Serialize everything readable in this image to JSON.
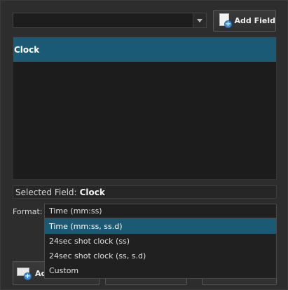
{
  "toolbar": {
    "field_select_value": "",
    "add_field_label": "Add Field"
  },
  "fields": [
    {
      "label": "Clock",
      "selected": true
    }
  ],
  "selected_field": {
    "label": "Selected Field:",
    "value": "Clock"
  },
  "format": {
    "label": "Format:",
    "selected": "Time (mm:ss)",
    "highlighted": "Time (mm:ss, ss.d)",
    "options": [
      "Time (mm:ss, ss.d)",
      "24sec shot clock (ss)",
      "24sec shot clock (ss, s.d)",
      "Custom"
    ]
  },
  "bottom_buttons": {
    "first_label_visible": "Ad"
  },
  "colors": {
    "selection": "#1a5a75",
    "background": "#2d2d2d",
    "list_background": "#1c1c1c",
    "accent_plus": "#3c8fd6"
  }
}
